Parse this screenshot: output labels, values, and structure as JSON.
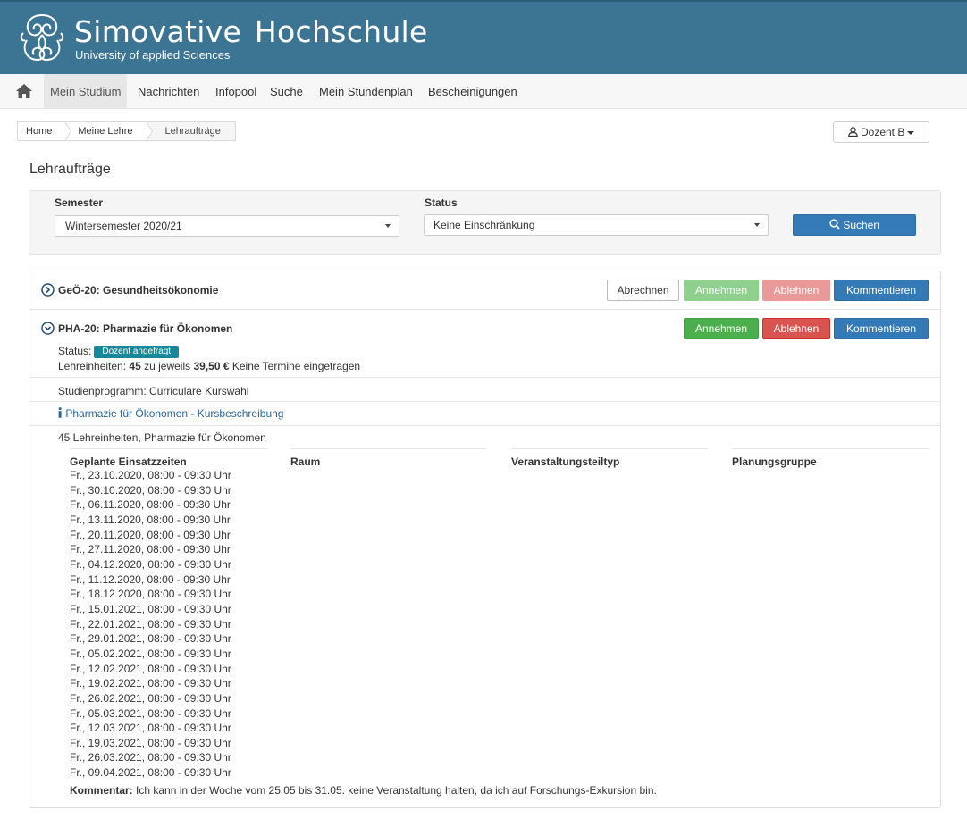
{
  "header": {
    "title": "Simovative Hochschule",
    "subtitle": "University of applied Sciences"
  },
  "nav": {
    "items": [
      "Mein Studium",
      "Nachrichten",
      "Infopool",
      "Suche",
      "Mein Stundenplan",
      "Bescheinigungen"
    ]
  },
  "breadcrumb": [
    "Home",
    "Meine Lehre",
    "Lehraufträge"
  ],
  "user": {
    "label": "Dozent B"
  },
  "page_title": "Lehraufträge",
  "filter": {
    "semester_label": "Semester",
    "semester_value": "Wintersemester 2020/21",
    "status_label": "Status",
    "status_value": "Keine Einschränkung",
    "search_label": "Suchen"
  },
  "course1": {
    "title": "GeÖ-20: Gesundheitsökonomie",
    "btn_abrechnen": "Abrechnen",
    "btn_annehmen": "Annehmen",
    "btn_ablehnen": "Ablehnen",
    "btn_kommentieren": "Kommentieren"
  },
  "course2": {
    "title": "PHA-20: Pharmazie für Ökonomen",
    "btn_annehmen": "Annehmen",
    "btn_ablehnen": "Ablehnen",
    "btn_kommentieren": "Kommentieren",
    "status_label": "Status:",
    "status_badge": "Dozent angefragt",
    "le_prefix": "Lehreinheiten:",
    "le_count": "45",
    "le_mid": "zu jeweils",
    "le_price": "39,50 €",
    "le_suffix": "Keine Termine eingetragen",
    "studienprogramm": "Studienprogramm: Curriculare Kurswahl",
    "link": "Pharmazie für Ökonomen - Kursbeschreibung",
    "units": "45 Lehreinheiten, Pharmazie für Ökonomen",
    "table_headers": [
      "Geplante Einsatzzeiten",
      "Raum",
      "Veranstaltungsteiltyp",
      "Planungsgruppe"
    ],
    "dates": [
      "Fr., 23.10.2020, 08:00 - 09:30 Uhr",
      "Fr., 30.10.2020, 08:00 - 09:30 Uhr",
      "Fr., 06.11.2020, 08:00 - 09:30 Uhr",
      "Fr., 13.11.2020, 08:00 - 09:30 Uhr",
      "Fr., 20.11.2020, 08:00 - 09:30 Uhr",
      "Fr., 27.11.2020, 08:00 - 09:30 Uhr",
      "Fr., 04.12.2020, 08:00 - 09:30 Uhr",
      "Fr., 11.12.2020, 08:00 - 09:30 Uhr",
      "Fr., 18.12.2020, 08:00 - 09:30 Uhr",
      "Fr., 15.01.2021, 08:00 - 09:30 Uhr",
      "Fr., 22.01.2021, 08:00 - 09:30 Uhr",
      "Fr., 29.01.2021, 08:00 - 09:30 Uhr",
      "Fr., 05.02.2021, 08:00 - 09:30 Uhr",
      "Fr., 12.02.2021, 08:00 - 09:30 Uhr",
      "Fr., 19.02.2021, 08:00 - 09:30 Uhr",
      "Fr., 26.02.2021, 08:00 - 09:30 Uhr",
      "Fr., 05.03.2021, 08:00 - 09:30 Uhr",
      "Fr., 12.03.2021, 08:00 - 09:30 Uhr",
      "Fr., 19.03.2021, 08:00 - 09:30 Uhr",
      "Fr., 26.03.2021, 08:00 - 09:30 Uhr",
      "Fr., 09.04.2021, 08:00 - 09:30 Uhr"
    ],
    "comment_label": "Kommentar:",
    "comment_text": "Ich kann in der Woche vom 25.05 bis 31.05. keine Veranstaltung halten, da ich auf Forschungs-Exkursion bin."
  },
  "colors": {
    "header_bg": "#3c7493",
    "primary": "#337ab7",
    "success": "#4cae4c",
    "danger": "#d9534f",
    "badge": "#17889a",
    "link": "#2a6496"
  },
  "icons": [
    "logo-icon",
    "home-icon",
    "user-icon",
    "chevron-circle-right-icon",
    "chevron-circle-down-icon",
    "info-icon",
    "search-icon",
    "caret-down-icon"
  ]
}
